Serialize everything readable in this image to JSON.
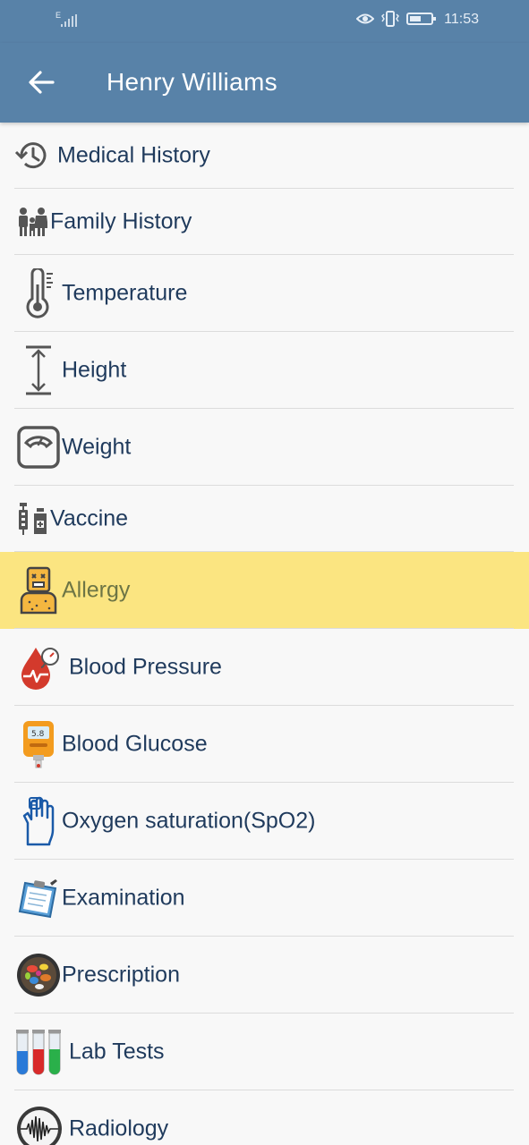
{
  "status_bar": {
    "network_label": "E",
    "time": "11:53"
  },
  "app_bar": {
    "title": "Henry Williams",
    "back_icon": "arrow-left-icon"
  },
  "menu": {
    "items": [
      {
        "label": "Medical History",
        "icon": "history-icon"
      },
      {
        "label": "Family History",
        "icon": "family-icon"
      },
      {
        "label": "Temperature",
        "icon": "thermometer-icon"
      },
      {
        "label": "Height",
        "icon": "height-icon"
      },
      {
        "label": "Weight",
        "icon": "scale-icon"
      },
      {
        "label": "Vaccine",
        "icon": "vaccine-icon"
      },
      {
        "label": "Allergy",
        "icon": "allergy-icon",
        "highlighted": true
      },
      {
        "label": "Blood Pressure",
        "icon": "blood-pressure-icon"
      },
      {
        "label": "Blood Glucose",
        "icon": "glucose-meter-icon"
      },
      {
        "label": "Oxygen saturation(SpO2)",
        "icon": "pulse-oximeter-icon"
      },
      {
        "label": "Examination",
        "icon": "clipboard-icon"
      },
      {
        "label": "Prescription",
        "icon": "pills-icon"
      },
      {
        "label": "Lab Tests",
        "icon": "test-tubes-icon"
      },
      {
        "label": "Radiology",
        "icon": "radiology-icon"
      }
    ]
  },
  "colors": {
    "app_bar": "#5882a8",
    "highlight": "#fbe581",
    "label": "#1f3a5c",
    "divider": "#dcdcdc"
  }
}
